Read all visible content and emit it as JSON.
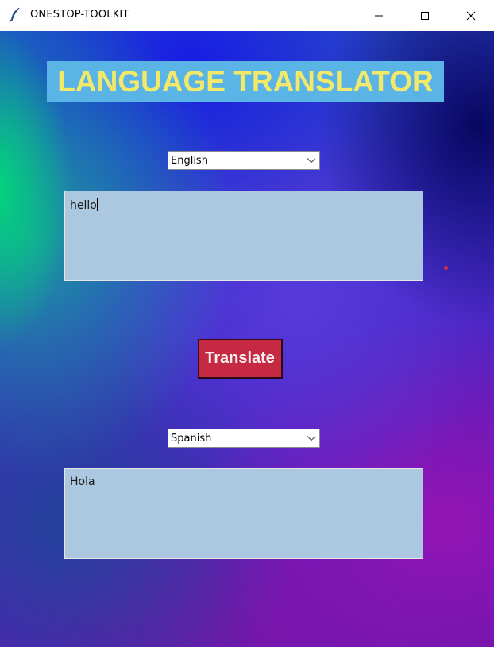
{
  "window": {
    "title": "ONESTOP-TOOLKIT",
    "icon": "feather-icon"
  },
  "header": {
    "title": "LANGUAGE TRANSLATOR"
  },
  "source": {
    "language": "English",
    "text": "hello"
  },
  "translate_button": {
    "label": "Translate"
  },
  "target": {
    "language": "Spanish",
    "text": "Hola"
  },
  "colors": {
    "header_bg": "#5ab4e6",
    "header_text": "#f2e86a",
    "textbox_bg": "#abc8e0",
    "button_bg": "#c62a42",
    "button_text": "#f6f0f0"
  }
}
